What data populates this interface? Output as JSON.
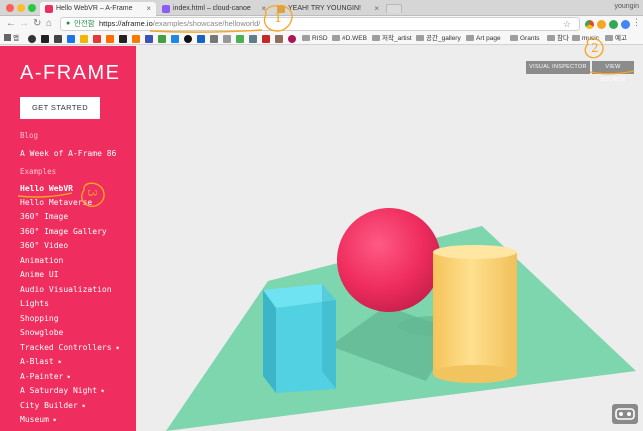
{
  "browser": {
    "tabs": [
      {
        "title": "Hello WebVR – A-Frame",
        "favicon_color": "#ef2d5e"
      },
      {
        "title": "index.html – cloud-canoe",
        "favicon_color": "#8b5cf6"
      },
      {
        "title": "YEAH! TRY YOUNGIN!",
        "favicon_color": "#e0a040"
      }
    ],
    "user_name": "youngin",
    "omnibox": {
      "secure_label": "안전함",
      "url_host": "https://aframe.io",
      "url_path": "/examples/showcase/helloworld/"
    },
    "bookmarks": [
      {
        "label": "RISD",
        "type": "folder"
      },
      {
        "label": "#D.WEB",
        "type": "folder"
      },
      {
        "label": "저작_artist",
        "type": "folder"
      },
      {
        "label": "공간_gallery",
        "type": "folder"
      },
      {
        "label": "Art page",
        "type": "folder"
      },
      {
        "label": "Grants",
        "type": "folder"
      },
      {
        "label": "참다",
        "type": "folder"
      },
      {
        "label": "music",
        "type": "folder"
      },
      {
        "label": "예고",
        "type": "folder"
      }
    ],
    "bookmark_app_label": "앱"
  },
  "sidebar": {
    "logo": "A-FRAME",
    "get_started": "GET STARTED",
    "blog_header": "Blog",
    "blog_items": [
      "A Week of A-Frame 86"
    ],
    "examples_header": "Examples",
    "examples": [
      "Hello WebVR",
      "Hello Metaverse",
      "360° Image",
      "360° Image Gallery",
      "360° Video",
      "Animation",
      "Anime UI",
      "Audio Visualization",
      "Lights",
      "Shopping",
      "Snowglobe",
      "Tracked Controllers",
      "A-Blast",
      "A-Painter",
      "A Saturday Night",
      "City Builder",
      "Museum"
    ],
    "active_example": "Hello WebVR"
  },
  "scene": {
    "visual_inspector": "VISUAL INSPECTOR",
    "view_source": "VIEW SOURCE",
    "colors": {
      "sphere": "#ef2d5e",
      "box": "#4cc3d9",
      "cylinder": "#ffc65d",
      "plane": "#7bc8a4",
      "sky": "#ececec"
    }
  },
  "annotations": {
    "one": "1",
    "two": "2",
    "three": "3"
  }
}
